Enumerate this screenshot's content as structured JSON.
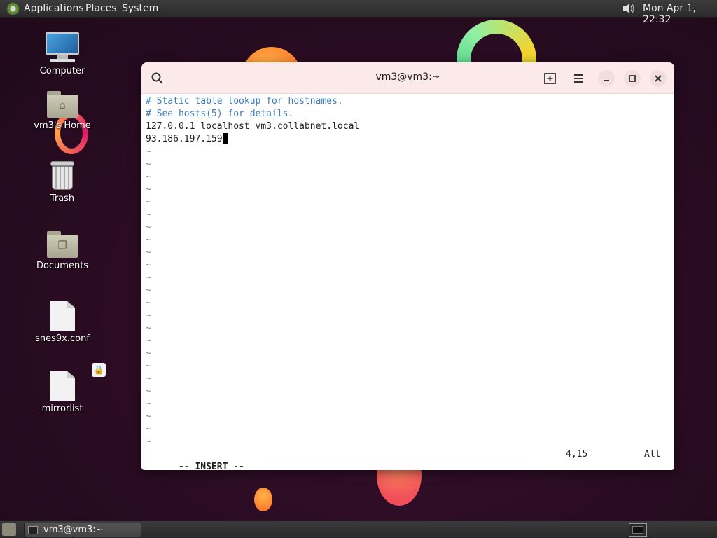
{
  "top_panel": {
    "menus": [
      "Applications",
      "Places",
      "System"
    ],
    "clock": "Mon Apr 1, 22:32"
  },
  "desktop": {
    "icons": [
      {
        "label": "Computer",
        "icon": "computer-icon"
      },
      {
        "label": "vm3's Home",
        "icon": "home-folder-icon"
      },
      {
        "label": "Trash",
        "icon": "trash-icon"
      },
      {
        "label": "Documents",
        "icon": "documents-folder-icon"
      },
      {
        "label": "snes9x.conf",
        "icon": "text-file-icon"
      },
      {
        "label": "mirrorlist",
        "icon": "text-file-icon"
      }
    ]
  },
  "terminal": {
    "title": "vm3@vm3:~",
    "lines": [
      "# Static table lookup for hostnames.",
      "# See hosts(5) for details.",
      "127.0.0.1 localhost vm3.collabnet.local",
      "93.186.197.159"
    ],
    "empty_line_marker": "~",
    "status": {
      "mode": "-- INSERT --",
      "position": "4,15",
      "scroll": "All"
    }
  },
  "bottom_panel": {
    "task_label": "vm3@vm3:~"
  },
  "colors": {
    "titlebar_bg": "#fce9e9",
    "comment": "#3c7dbd",
    "panel_bg": "#2b2b2b"
  }
}
